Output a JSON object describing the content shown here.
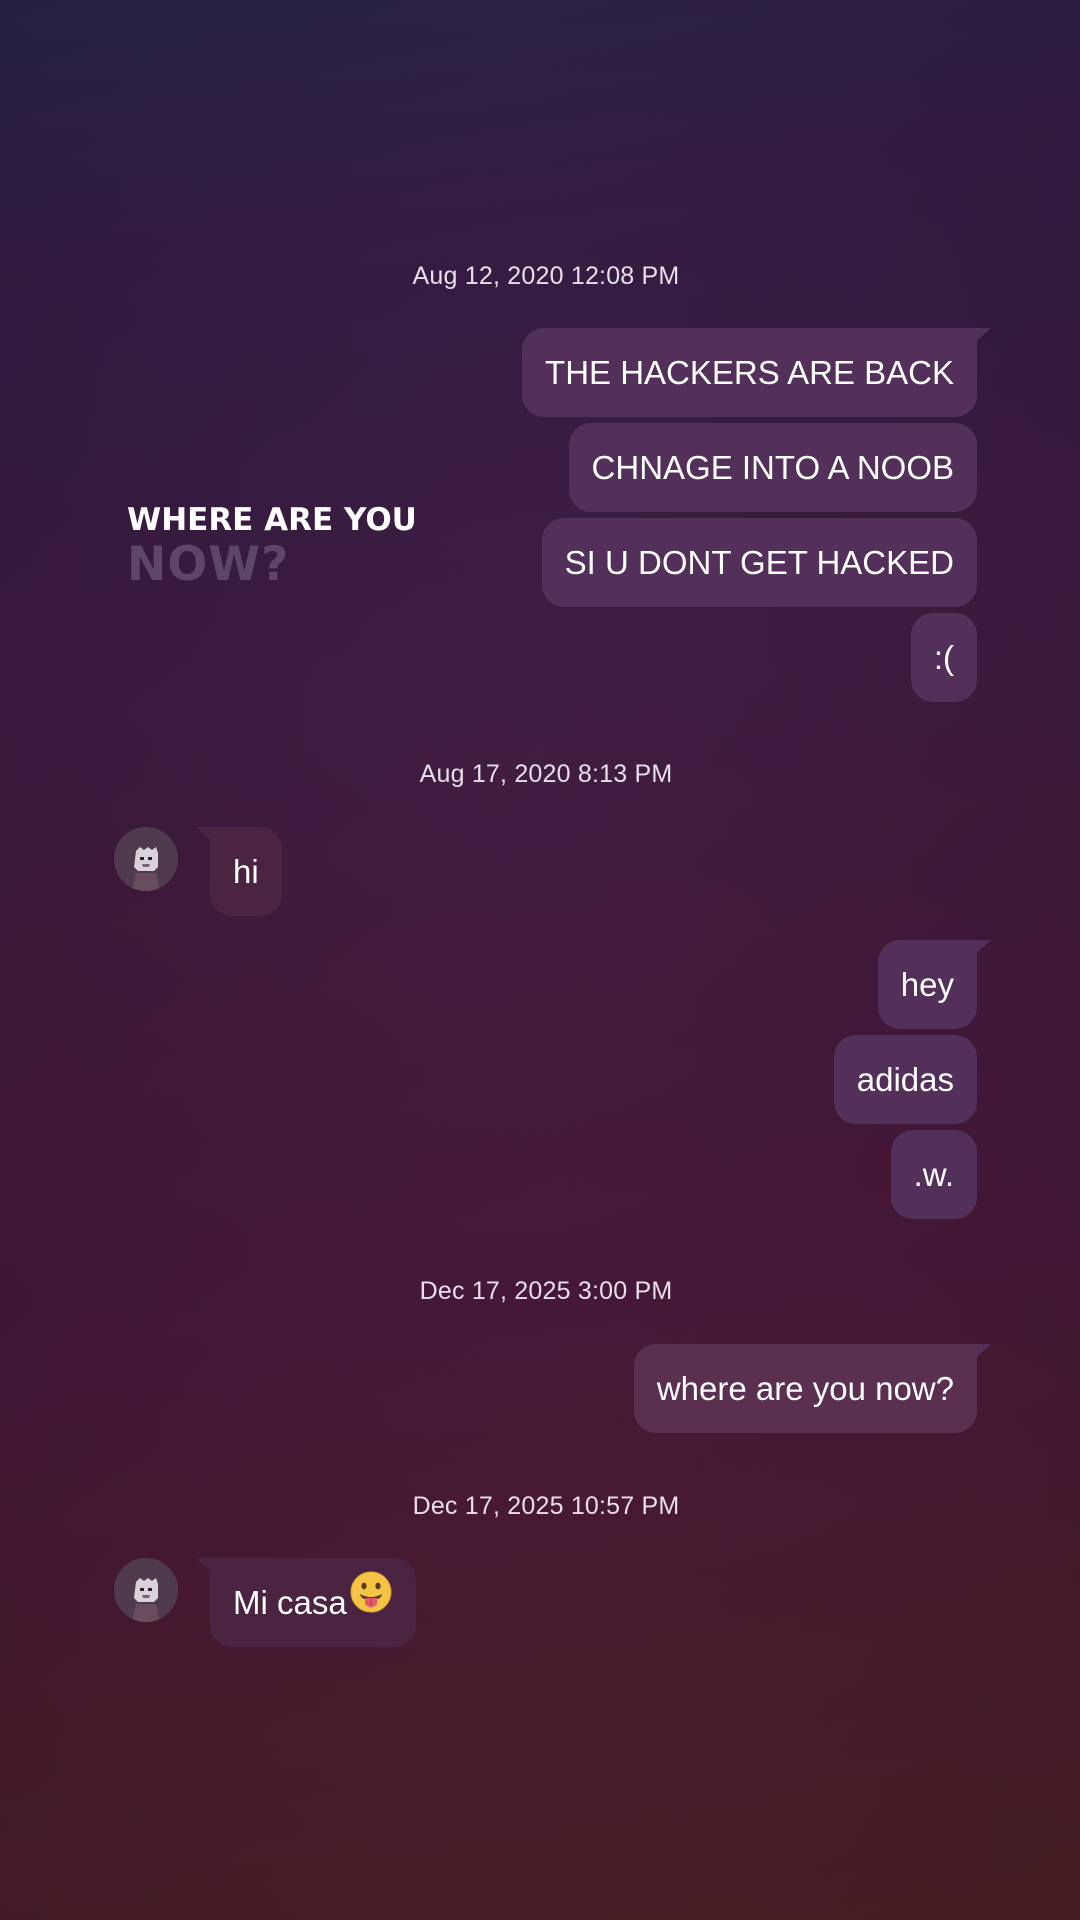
{
  "watermark": {
    "line1": "WHERE ARE YOU",
    "line2": "NOW?"
  },
  "timestamps": [
    "Aug 12, 2020 12:08 PM",
    "Aug 17, 2020 8:13 PM",
    "Dec 17, 2025 3:00 PM",
    "Dec 17, 2025 10:57 PM"
  ],
  "messages": [
    {
      "direction": "outgoing",
      "text": "THE HACKERS ARE BACK"
    },
    {
      "direction": "outgoing",
      "text": "CHNAGE INTO A NOOB"
    },
    {
      "direction": "outgoing",
      "text": "SI U DONT GET HACKED"
    },
    {
      "direction": "outgoing",
      "text": ":("
    },
    {
      "direction": "incoming",
      "text": "hi"
    },
    {
      "direction": "outgoing",
      "text": "hey"
    },
    {
      "direction": "outgoing",
      "text": "adidas"
    },
    {
      "direction": "outgoing",
      "text": ".w."
    },
    {
      "direction": "outgoing",
      "text": "where are you now?"
    },
    {
      "direction": "incoming",
      "text": "Mi casa",
      "emoji": "tongue-out-emoji"
    }
  ],
  "colors": {
    "outgoing_bubble": "#53305a",
    "incoming_bubble": "#4a2441",
    "watermark_accent": "#5d4669"
  }
}
